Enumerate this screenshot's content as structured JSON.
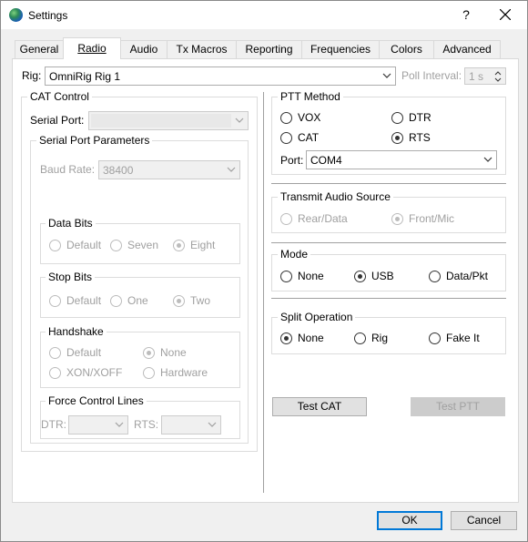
{
  "window": {
    "title": "Settings",
    "help_label": "?"
  },
  "tabs": [
    {
      "label": "General"
    },
    {
      "label": "Radio"
    },
    {
      "label": "Audio"
    },
    {
      "label": "Tx Macros"
    },
    {
      "label": "Reporting"
    },
    {
      "label": "Frequencies"
    },
    {
      "label": "Colors"
    },
    {
      "label": "Advanced"
    }
  ],
  "rig": {
    "label": "Rig:",
    "value": "OmniRig Rig 1",
    "poll_label": "Poll Interval:",
    "poll_value": "1 s"
  },
  "cat_control": {
    "title": "CAT Control",
    "serial_port_label": "Serial Port:",
    "serial_port_value": "",
    "params_title": "Serial Port Parameters",
    "baud_label": "Baud Rate:",
    "baud_value": "38400",
    "data_bits": {
      "title": "Data Bits",
      "options": [
        "Default",
        "Seven",
        "Eight"
      ]
    },
    "stop_bits": {
      "title": "Stop Bits",
      "options": [
        "Default",
        "One",
        "Two"
      ]
    },
    "handshake": {
      "title": "Handshake",
      "options": [
        "Default",
        "None",
        "XON/XOFF",
        "Hardware"
      ]
    },
    "force": {
      "title": "Force Control Lines",
      "dtr_label": "DTR:",
      "rts_label": "RTS:"
    }
  },
  "ptt": {
    "title": "PTT Method",
    "options": [
      "VOX",
      "DTR",
      "CAT",
      "RTS"
    ],
    "port_label": "Port:",
    "port_value": "COM4"
  },
  "tx_audio": {
    "title": "Transmit Audio Source",
    "options": [
      "Rear/Data",
      "Front/Mic"
    ]
  },
  "mode": {
    "title": "Mode",
    "options": [
      "None",
      "USB",
      "Data/Pkt"
    ]
  },
  "split": {
    "title": "Split Operation",
    "options": [
      "None",
      "Rig",
      "Fake It"
    ]
  },
  "buttons": {
    "test_cat": "Test CAT",
    "test_ptt": "Test PTT",
    "ok": "OK",
    "cancel": "Cancel"
  }
}
